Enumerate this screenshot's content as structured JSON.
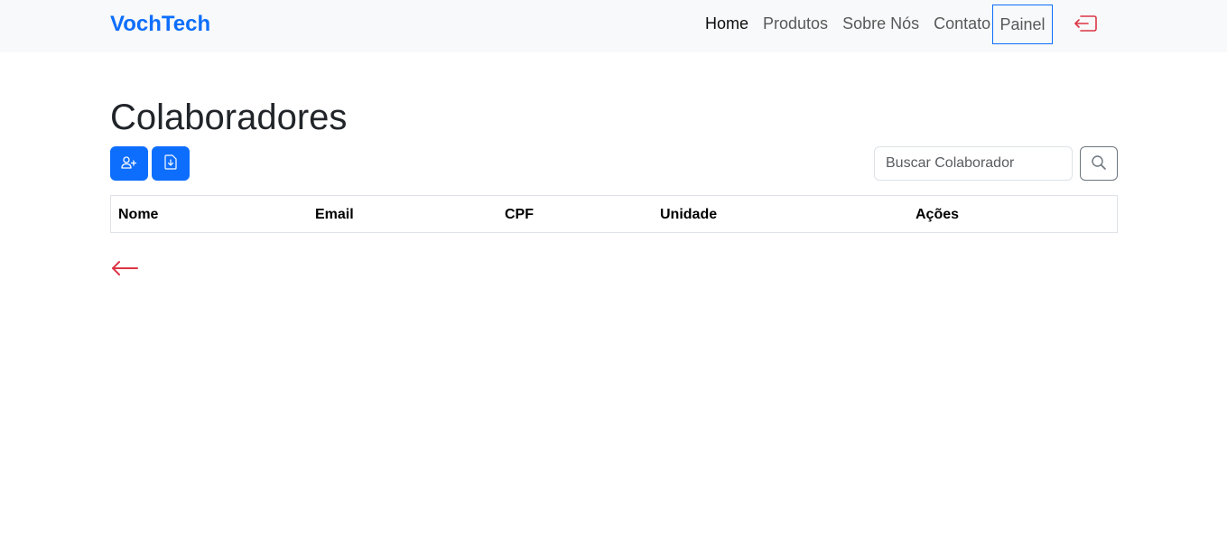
{
  "navbar": {
    "brand": "VochTech",
    "links": [
      {
        "label": "Home"
      },
      {
        "label": "Produtos"
      },
      {
        "label": "Sobre Nós"
      },
      {
        "label": "Contato"
      }
    ],
    "panel_label": "Painel",
    "logout_icon": "logout-icon"
  },
  "main": {
    "title": "Colaboradores",
    "add_button_icon": "person-plus-icon",
    "export_button_icon": "file-download-icon",
    "search": {
      "placeholder": "Buscar Colaborador",
      "value": ""
    },
    "search_button_icon": "search-icon",
    "table": {
      "columns": [
        "Nome",
        "Email",
        "CPF",
        "Unidade",
        "Ações"
      ],
      "rows": []
    },
    "back_icon": "arrow-left-icon"
  },
  "colors": {
    "primary": "#0d6efd",
    "danger": "#dc3545",
    "navbar_bg": "#f8f9fa"
  }
}
